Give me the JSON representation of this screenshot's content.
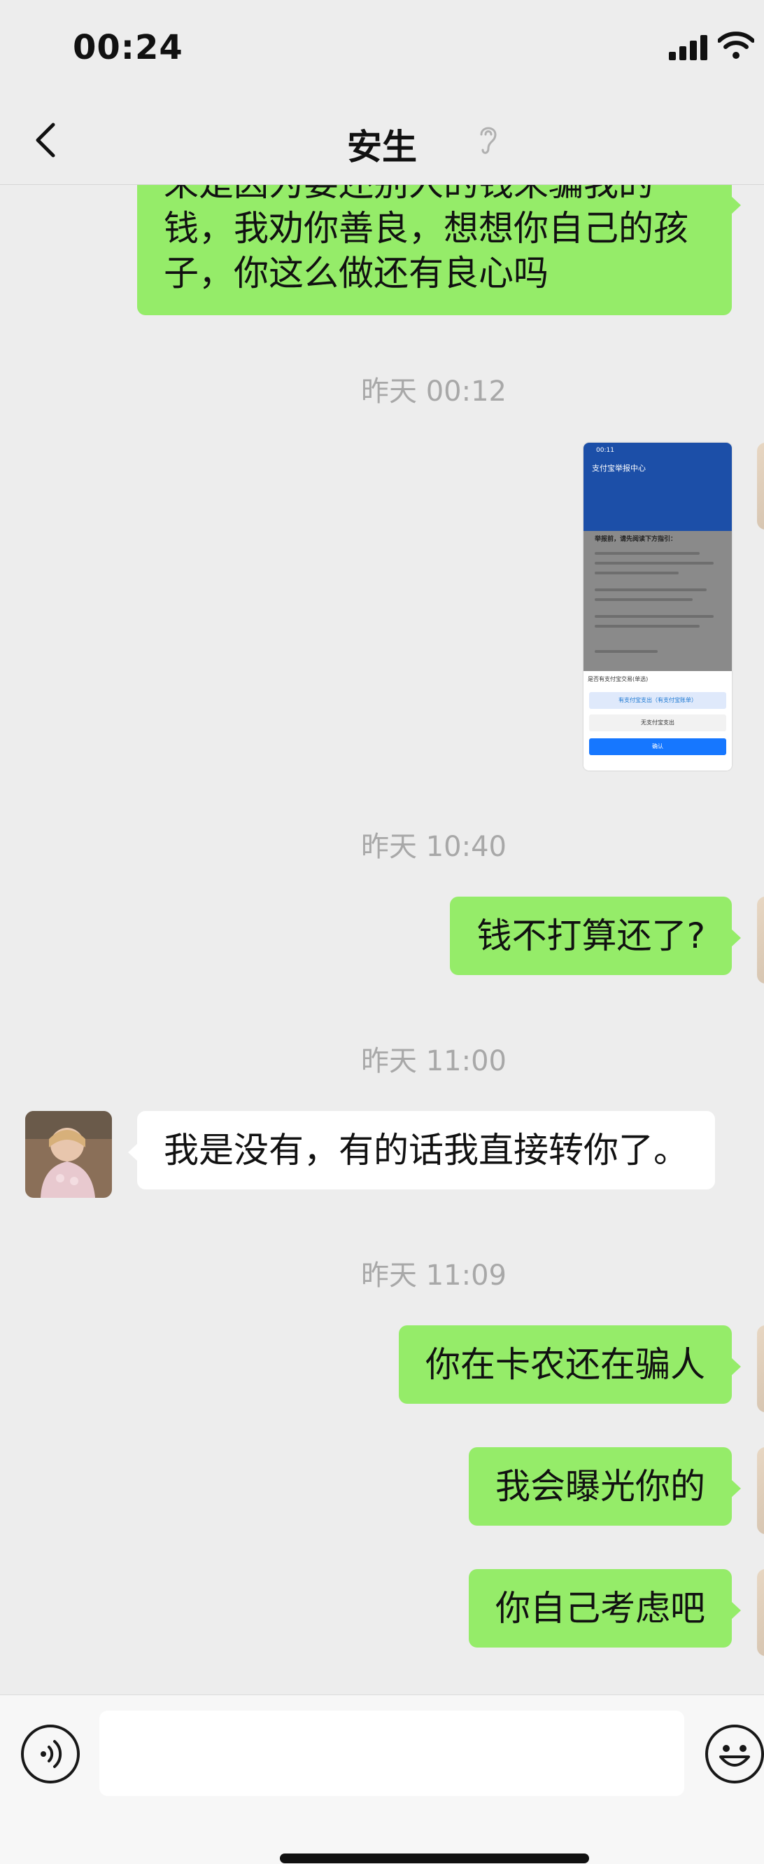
{
  "status_bar": {
    "time": "00:24"
  },
  "header": {
    "title": "安生"
  },
  "messages": {
    "m1": {
      "lines": [
        "来是因为要还别人的钱来骗我的",
        "钱，我劝你善良，想想你自己的孩",
        "子，你这么做还有良心吗"
      ]
    },
    "t1": "昨天 00:12",
    "screenshot": {
      "time": "00:11",
      "title": "支付宝举报中心",
      "heading": "举报前，请先阅读下方指引：",
      "sheet_title": "是否有支付宝交易(单选)",
      "option1": "有支付宝支出（有支付宝账单）",
      "option2": "无支付宝支出",
      "confirm": "确认"
    },
    "t2": "昨天 10:40",
    "m2": "钱不打算还了?",
    "t3": "昨天 11:00",
    "m3": "我是没有，有的话我直接转你了。",
    "t4": "昨天 11:09",
    "m4": "你在卡农还在骗人",
    "m5": "我会曝光你的",
    "m6": "你自己考虑吧"
  },
  "input_bar": {
    "placeholder": ""
  },
  "colors": {
    "outgoing_bubble": "#95ec69",
    "incoming_bubble": "#ffffff",
    "background": "#ededed"
  }
}
